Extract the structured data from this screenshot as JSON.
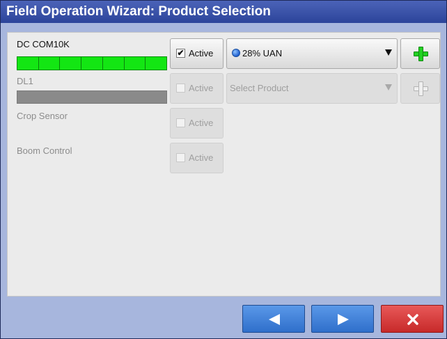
{
  "window": {
    "title": "Field Operation Wizard: Product Selection"
  },
  "devices": [
    {
      "name": "DC COM10K",
      "enabled": true,
      "meter": "green",
      "active_label": "Active",
      "active_checked": true,
      "product": "28% UAN",
      "product_icon": "blue-dot-icon"
    },
    {
      "name": "DL1",
      "enabled": false,
      "meter": "gray",
      "active_label": "Active",
      "active_checked": false,
      "product": "Select Product"
    },
    {
      "name": "Crop Sensor",
      "enabled": false,
      "active_label": "Active",
      "active_checked": false
    },
    {
      "name": "Boom Control",
      "enabled": false,
      "active_label": "Active",
      "active_checked": false
    }
  ],
  "checkmark_glyph": "✔",
  "nav": {
    "back_icon": "left-arrow-icon",
    "next_icon": "right-arrow-icon",
    "cancel_icon": "x-icon"
  },
  "colors": {
    "title_bg": "#2c449a",
    "frame_bg": "#a7b6dd",
    "meter_green": "#13e613",
    "nav_blue": "#2f6fcb",
    "cancel_red": "#c72a2a"
  }
}
